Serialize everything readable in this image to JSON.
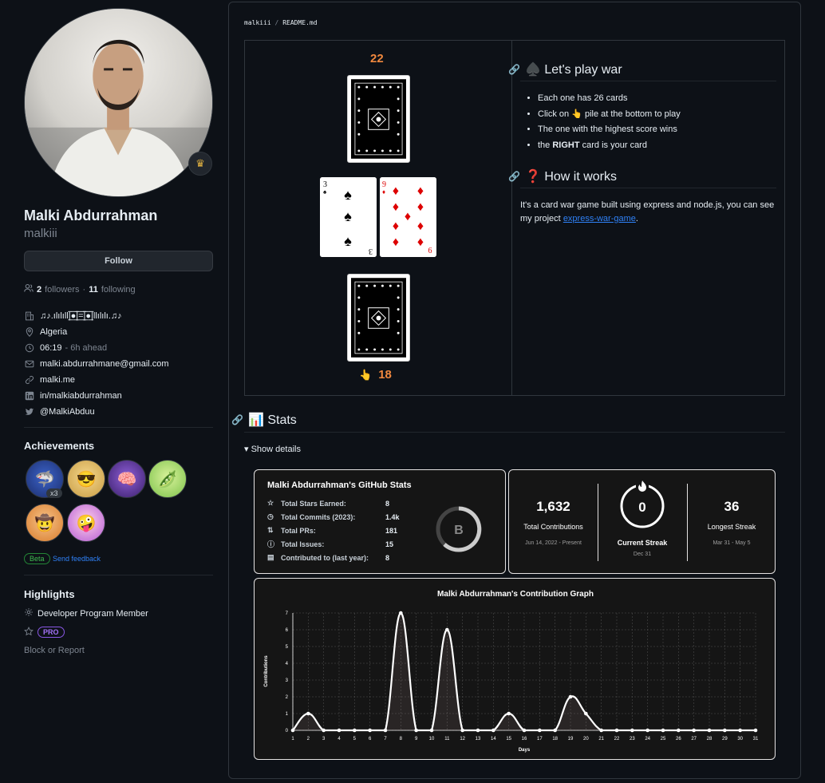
{
  "profile": {
    "name": "Malki Abdurrahman",
    "login": "malkiii",
    "follow_label": "Follow",
    "followers_count": "2",
    "followers_label": "followers",
    "following_count": "11",
    "following_label": "following",
    "org": "♫♪.ılılıll|̲̅̅●̲̅̅|̲̅̅=̲̅̅|̲̅̅●̲̅̅|llılılı.♫♪",
    "location": "Algeria",
    "local_time": "06:19",
    "time_offset": "- 6h ahead",
    "email": "malki.abdurrahmane@gmail.com",
    "website": "malki.me",
    "linkedin": "in/malkiabdurrahman",
    "twitter": "@MalkiAbduu"
  },
  "achievements": {
    "title": "Achievements",
    "count_badge": "x3",
    "beta_label": "Beta",
    "feedback_label": "Send feedback"
  },
  "highlights": {
    "title": "Highlights",
    "developer_program": "Developer Program Member",
    "pro_label": "PRO",
    "block_report": "Block or Report"
  },
  "readme": {
    "crumb_user": "malkiii",
    "crumb_sep": "/",
    "crumb_file": "README.md",
    "opponent_score": "22",
    "player_hand": "👆",
    "player_score": "18",
    "war_heading": "♠️ Let's play war",
    "war_rules": [
      "Each one has 26 cards",
      "pile at the bottom to play",
      "The one with the highest score wins",
      "card is your card"
    ],
    "rule2_prefix": "Click on",
    "rule2_emoji": "👆",
    "rule4_prefix": "the",
    "rule4_bold": "RIGHT",
    "how_heading": "❓ How it works",
    "how_text": "It's a card war game built using express and node.js, you can see my project",
    "how_link": "express-war-game",
    "how_end": ".",
    "stats_heading": "📊 Stats",
    "show_details": "Show details"
  },
  "github_stats": {
    "title": "Malki Abdurrahman's GitHub Stats",
    "rows": [
      {
        "label": "Total Stars Earned:",
        "value": "8"
      },
      {
        "label": "Total Commits (2023):",
        "value": "1.4k"
      },
      {
        "label": "Total PRs:",
        "value": "181"
      },
      {
        "label": "Total Issues:",
        "value": "15"
      },
      {
        "label": "Contributed to (last year):",
        "value": "8"
      }
    ],
    "rank": "B"
  },
  "streak": {
    "total": "1,632",
    "total_label": "Total Contributions",
    "total_range": "Jun 14, 2022 - Present",
    "current": "0",
    "current_label": "Current Streak",
    "current_range": "Dec 31",
    "longest": "36",
    "longest_label": "Longest Streak",
    "longest_range": "Mar 31 - May 5"
  },
  "colors": {
    "accent_orange": "#f0883e",
    "link_blue": "#2f81f7",
    "bg": "#0d1117"
  },
  "chart_data": {
    "type": "line",
    "title": "Malki Abdurrahman's Contribution Graph",
    "xlabel": "Days",
    "ylabel": "Contributions",
    "x": [
      1,
      2,
      3,
      4,
      5,
      6,
      7,
      8,
      9,
      10,
      11,
      12,
      13,
      14,
      15,
      16,
      17,
      18,
      19,
      20,
      21,
      22,
      23,
      24,
      25,
      26,
      27,
      28,
      29,
      30,
      31
    ],
    "values": [
      0,
      1,
      0,
      0,
      0,
      0,
      0,
      7,
      0,
      0,
      6,
      0,
      0,
      0,
      1,
      0,
      0,
      0,
      2,
      1,
      0,
      0,
      0,
      0,
      0,
      0,
      0,
      0,
      0,
      0,
      0
    ],
    "ylim": [
      0,
      7
    ],
    "yticks": [
      0,
      1,
      2,
      3,
      4,
      5,
      6,
      7
    ],
    "grid": true
  }
}
